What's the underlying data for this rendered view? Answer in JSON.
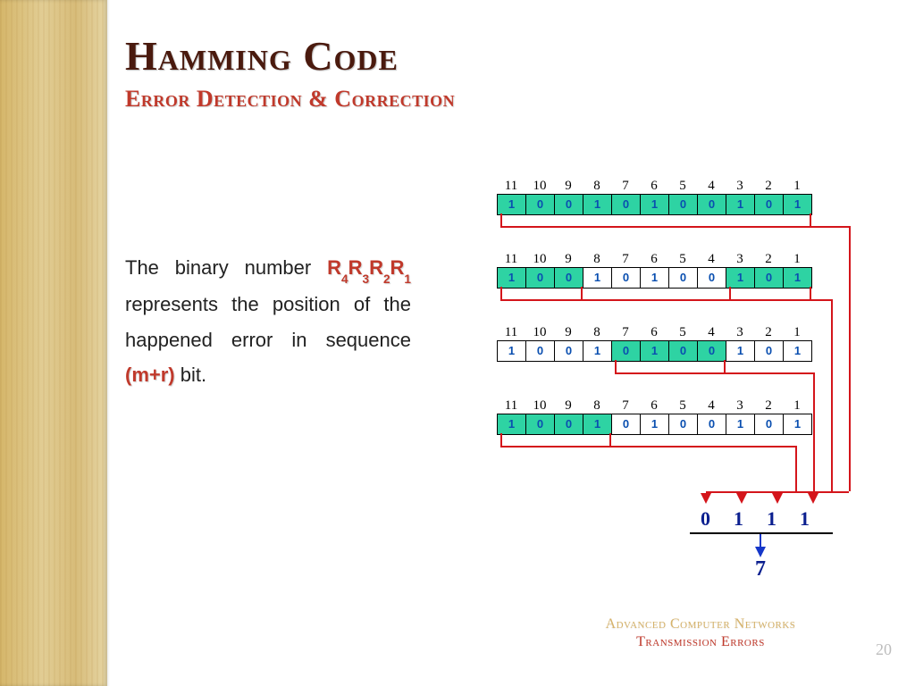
{
  "title": "Hamming Code",
  "subtitle": "Error Detection & Correction",
  "body": {
    "pre": "The binary number ",
    "r4": "R",
    "r3": "R",
    "r2": "R",
    "r1": "R",
    "mid": " represents the position of the happened error in sequence ",
    "mr": "(m+r)",
    "post": " bit."
  },
  "positions": [
    "11",
    "10",
    "9",
    "8",
    "7",
    "6",
    "5",
    "4",
    "3",
    "2",
    "1"
  ],
  "rows": [
    {
      "highlight": [
        11,
        10,
        9,
        8,
        7,
        6,
        5,
        4,
        3,
        2,
        1
      ],
      "bits": [
        "1",
        "0",
        "0",
        "1",
        "0",
        "1",
        "0",
        "0",
        "1",
        "0",
        "1"
      ]
    },
    {
      "highlight": [
        11,
        10,
        9,
        3,
        2,
        1
      ],
      "bits": [
        "1",
        "0",
        "0",
        "1",
        "0",
        "1",
        "0",
        "0",
        "1",
        "0",
        "1"
      ]
    },
    {
      "highlight": [
        7,
        6,
        5,
        4
      ],
      "bits": [
        "1",
        "0",
        "0",
        "1",
        "0",
        "1",
        "0",
        "0",
        "1",
        "0",
        "1"
      ]
    },
    {
      "highlight": [
        11,
        10,
        9,
        8
      ],
      "bits": [
        "1",
        "0",
        "0",
        "1",
        "0",
        "1",
        "0",
        "0",
        "1",
        "0",
        "1"
      ]
    }
  ],
  "result_bits": [
    "0",
    "1",
    "1",
    "1"
  ],
  "result_value": "7",
  "footer_a": "Advanced Computer Networks",
  "footer_b": "Transmission Errors",
  "page": "20"
}
